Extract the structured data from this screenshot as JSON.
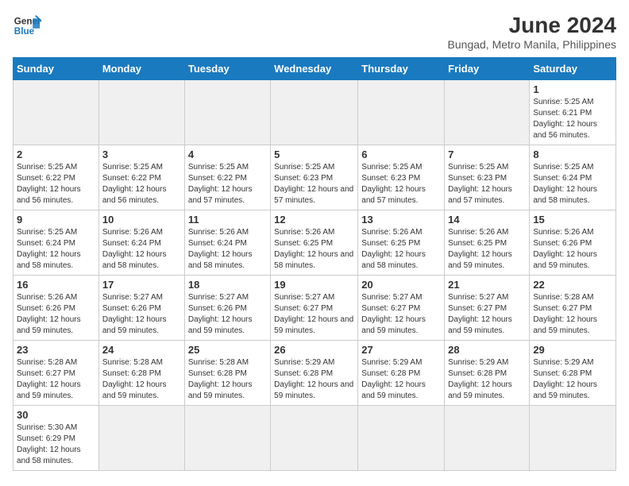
{
  "logo": {
    "line1": "General",
    "line2": "Blue"
  },
  "title": "June 2024",
  "subtitle": "Bungad, Metro Manila, Philippines",
  "days_of_week": [
    "Sunday",
    "Monday",
    "Tuesday",
    "Wednesday",
    "Thursday",
    "Friday",
    "Saturday"
  ],
  "weeks": [
    [
      {
        "day": "",
        "info": "",
        "empty": true
      },
      {
        "day": "",
        "info": "",
        "empty": true
      },
      {
        "day": "",
        "info": "",
        "empty": true
      },
      {
        "day": "",
        "info": "",
        "empty": true
      },
      {
        "day": "",
        "info": "",
        "empty": true
      },
      {
        "day": "",
        "info": "",
        "empty": true
      },
      {
        "day": "1",
        "info": "Sunrise: 5:25 AM\nSunset: 6:21 PM\nDaylight: 12 hours and 56 minutes."
      }
    ],
    [
      {
        "day": "2",
        "info": "Sunrise: 5:25 AM\nSunset: 6:22 PM\nDaylight: 12 hours and 56 minutes."
      },
      {
        "day": "3",
        "info": "Sunrise: 5:25 AM\nSunset: 6:22 PM\nDaylight: 12 hours and 56 minutes."
      },
      {
        "day": "4",
        "info": "Sunrise: 5:25 AM\nSunset: 6:22 PM\nDaylight: 12 hours and 57 minutes."
      },
      {
        "day": "5",
        "info": "Sunrise: 5:25 AM\nSunset: 6:23 PM\nDaylight: 12 hours and 57 minutes."
      },
      {
        "day": "6",
        "info": "Sunrise: 5:25 AM\nSunset: 6:23 PM\nDaylight: 12 hours and 57 minutes."
      },
      {
        "day": "7",
        "info": "Sunrise: 5:25 AM\nSunset: 6:23 PM\nDaylight: 12 hours and 57 minutes."
      },
      {
        "day": "8",
        "info": "Sunrise: 5:25 AM\nSunset: 6:24 PM\nDaylight: 12 hours and 58 minutes."
      }
    ],
    [
      {
        "day": "9",
        "info": "Sunrise: 5:25 AM\nSunset: 6:24 PM\nDaylight: 12 hours and 58 minutes."
      },
      {
        "day": "10",
        "info": "Sunrise: 5:26 AM\nSunset: 6:24 PM\nDaylight: 12 hours and 58 minutes."
      },
      {
        "day": "11",
        "info": "Sunrise: 5:26 AM\nSunset: 6:24 PM\nDaylight: 12 hours and 58 minutes."
      },
      {
        "day": "12",
        "info": "Sunrise: 5:26 AM\nSunset: 6:25 PM\nDaylight: 12 hours and 58 minutes."
      },
      {
        "day": "13",
        "info": "Sunrise: 5:26 AM\nSunset: 6:25 PM\nDaylight: 12 hours and 58 minutes."
      },
      {
        "day": "14",
        "info": "Sunrise: 5:26 AM\nSunset: 6:25 PM\nDaylight: 12 hours and 59 minutes."
      },
      {
        "day": "15",
        "info": "Sunrise: 5:26 AM\nSunset: 6:26 PM\nDaylight: 12 hours and 59 minutes."
      }
    ],
    [
      {
        "day": "16",
        "info": "Sunrise: 5:26 AM\nSunset: 6:26 PM\nDaylight: 12 hours and 59 minutes."
      },
      {
        "day": "17",
        "info": "Sunrise: 5:27 AM\nSunset: 6:26 PM\nDaylight: 12 hours and 59 minutes."
      },
      {
        "day": "18",
        "info": "Sunrise: 5:27 AM\nSunset: 6:26 PM\nDaylight: 12 hours and 59 minutes."
      },
      {
        "day": "19",
        "info": "Sunrise: 5:27 AM\nSunset: 6:27 PM\nDaylight: 12 hours and 59 minutes."
      },
      {
        "day": "20",
        "info": "Sunrise: 5:27 AM\nSunset: 6:27 PM\nDaylight: 12 hours and 59 minutes."
      },
      {
        "day": "21",
        "info": "Sunrise: 5:27 AM\nSunset: 6:27 PM\nDaylight: 12 hours and 59 minutes."
      },
      {
        "day": "22",
        "info": "Sunrise: 5:28 AM\nSunset: 6:27 PM\nDaylight: 12 hours and 59 minutes."
      }
    ],
    [
      {
        "day": "23",
        "info": "Sunrise: 5:28 AM\nSunset: 6:27 PM\nDaylight: 12 hours and 59 minutes."
      },
      {
        "day": "24",
        "info": "Sunrise: 5:28 AM\nSunset: 6:28 PM\nDaylight: 12 hours and 59 minutes."
      },
      {
        "day": "25",
        "info": "Sunrise: 5:28 AM\nSunset: 6:28 PM\nDaylight: 12 hours and 59 minutes."
      },
      {
        "day": "26",
        "info": "Sunrise: 5:29 AM\nSunset: 6:28 PM\nDaylight: 12 hours and 59 minutes."
      },
      {
        "day": "27",
        "info": "Sunrise: 5:29 AM\nSunset: 6:28 PM\nDaylight: 12 hours and 59 minutes."
      },
      {
        "day": "28",
        "info": "Sunrise: 5:29 AM\nSunset: 6:28 PM\nDaylight: 12 hours and 59 minutes."
      },
      {
        "day": "29",
        "info": "Sunrise: 5:29 AM\nSunset: 6:28 PM\nDaylight: 12 hours and 59 minutes."
      }
    ],
    [
      {
        "day": "30",
        "info": "Sunrise: 5:30 AM\nSunset: 6:29 PM\nDaylight: 12 hours and 58 minutes."
      },
      {
        "day": "",
        "info": "",
        "empty": true
      },
      {
        "day": "",
        "info": "",
        "empty": true
      },
      {
        "day": "",
        "info": "",
        "empty": true
      },
      {
        "day": "",
        "info": "",
        "empty": true
      },
      {
        "day": "",
        "info": "",
        "empty": true
      },
      {
        "day": "",
        "info": "",
        "empty": true
      }
    ]
  ]
}
